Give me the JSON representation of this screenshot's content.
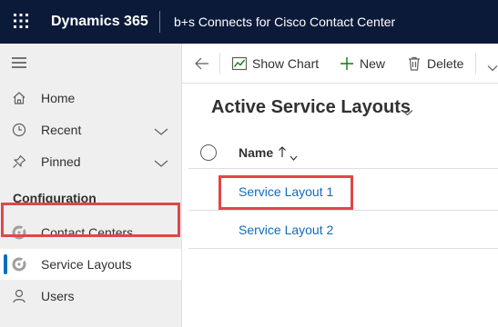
{
  "header": {
    "app_name": "Dynamics 365",
    "app_title": "b+s Connects for Cisco Contact Center"
  },
  "sidebar": {
    "items": [
      {
        "label": "Home",
        "icon": "home-icon"
      },
      {
        "label": "Recent",
        "icon": "clock-icon"
      },
      {
        "label": "Pinned",
        "icon": "pin-icon"
      }
    ],
    "section_header": "Configuration",
    "section_items": [
      {
        "label": "Contact Centers",
        "icon": "entity-icon"
      },
      {
        "label": "Service Layouts",
        "icon": "entity-icon",
        "selected": true
      },
      {
        "label": "Users",
        "icon": "person-icon"
      }
    ]
  },
  "commandbar": {
    "show_chart": "Show Chart",
    "new": "New",
    "delete": "Delete"
  },
  "view": {
    "title": "Active Service Layouts"
  },
  "grid": {
    "columns": [
      {
        "label": "Name",
        "sort": "ascending"
      }
    ],
    "rows": [
      {
        "name": "Service Layout 1"
      },
      {
        "name": "Service Layout 2"
      }
    ]
  },
  "colors": {
    "topbar": "#0c1a3a",
    "accent": "#0f6cbd",
    "highlight": "#e0464b",
    "sidebar_bg": "#efefef"
  }
}
